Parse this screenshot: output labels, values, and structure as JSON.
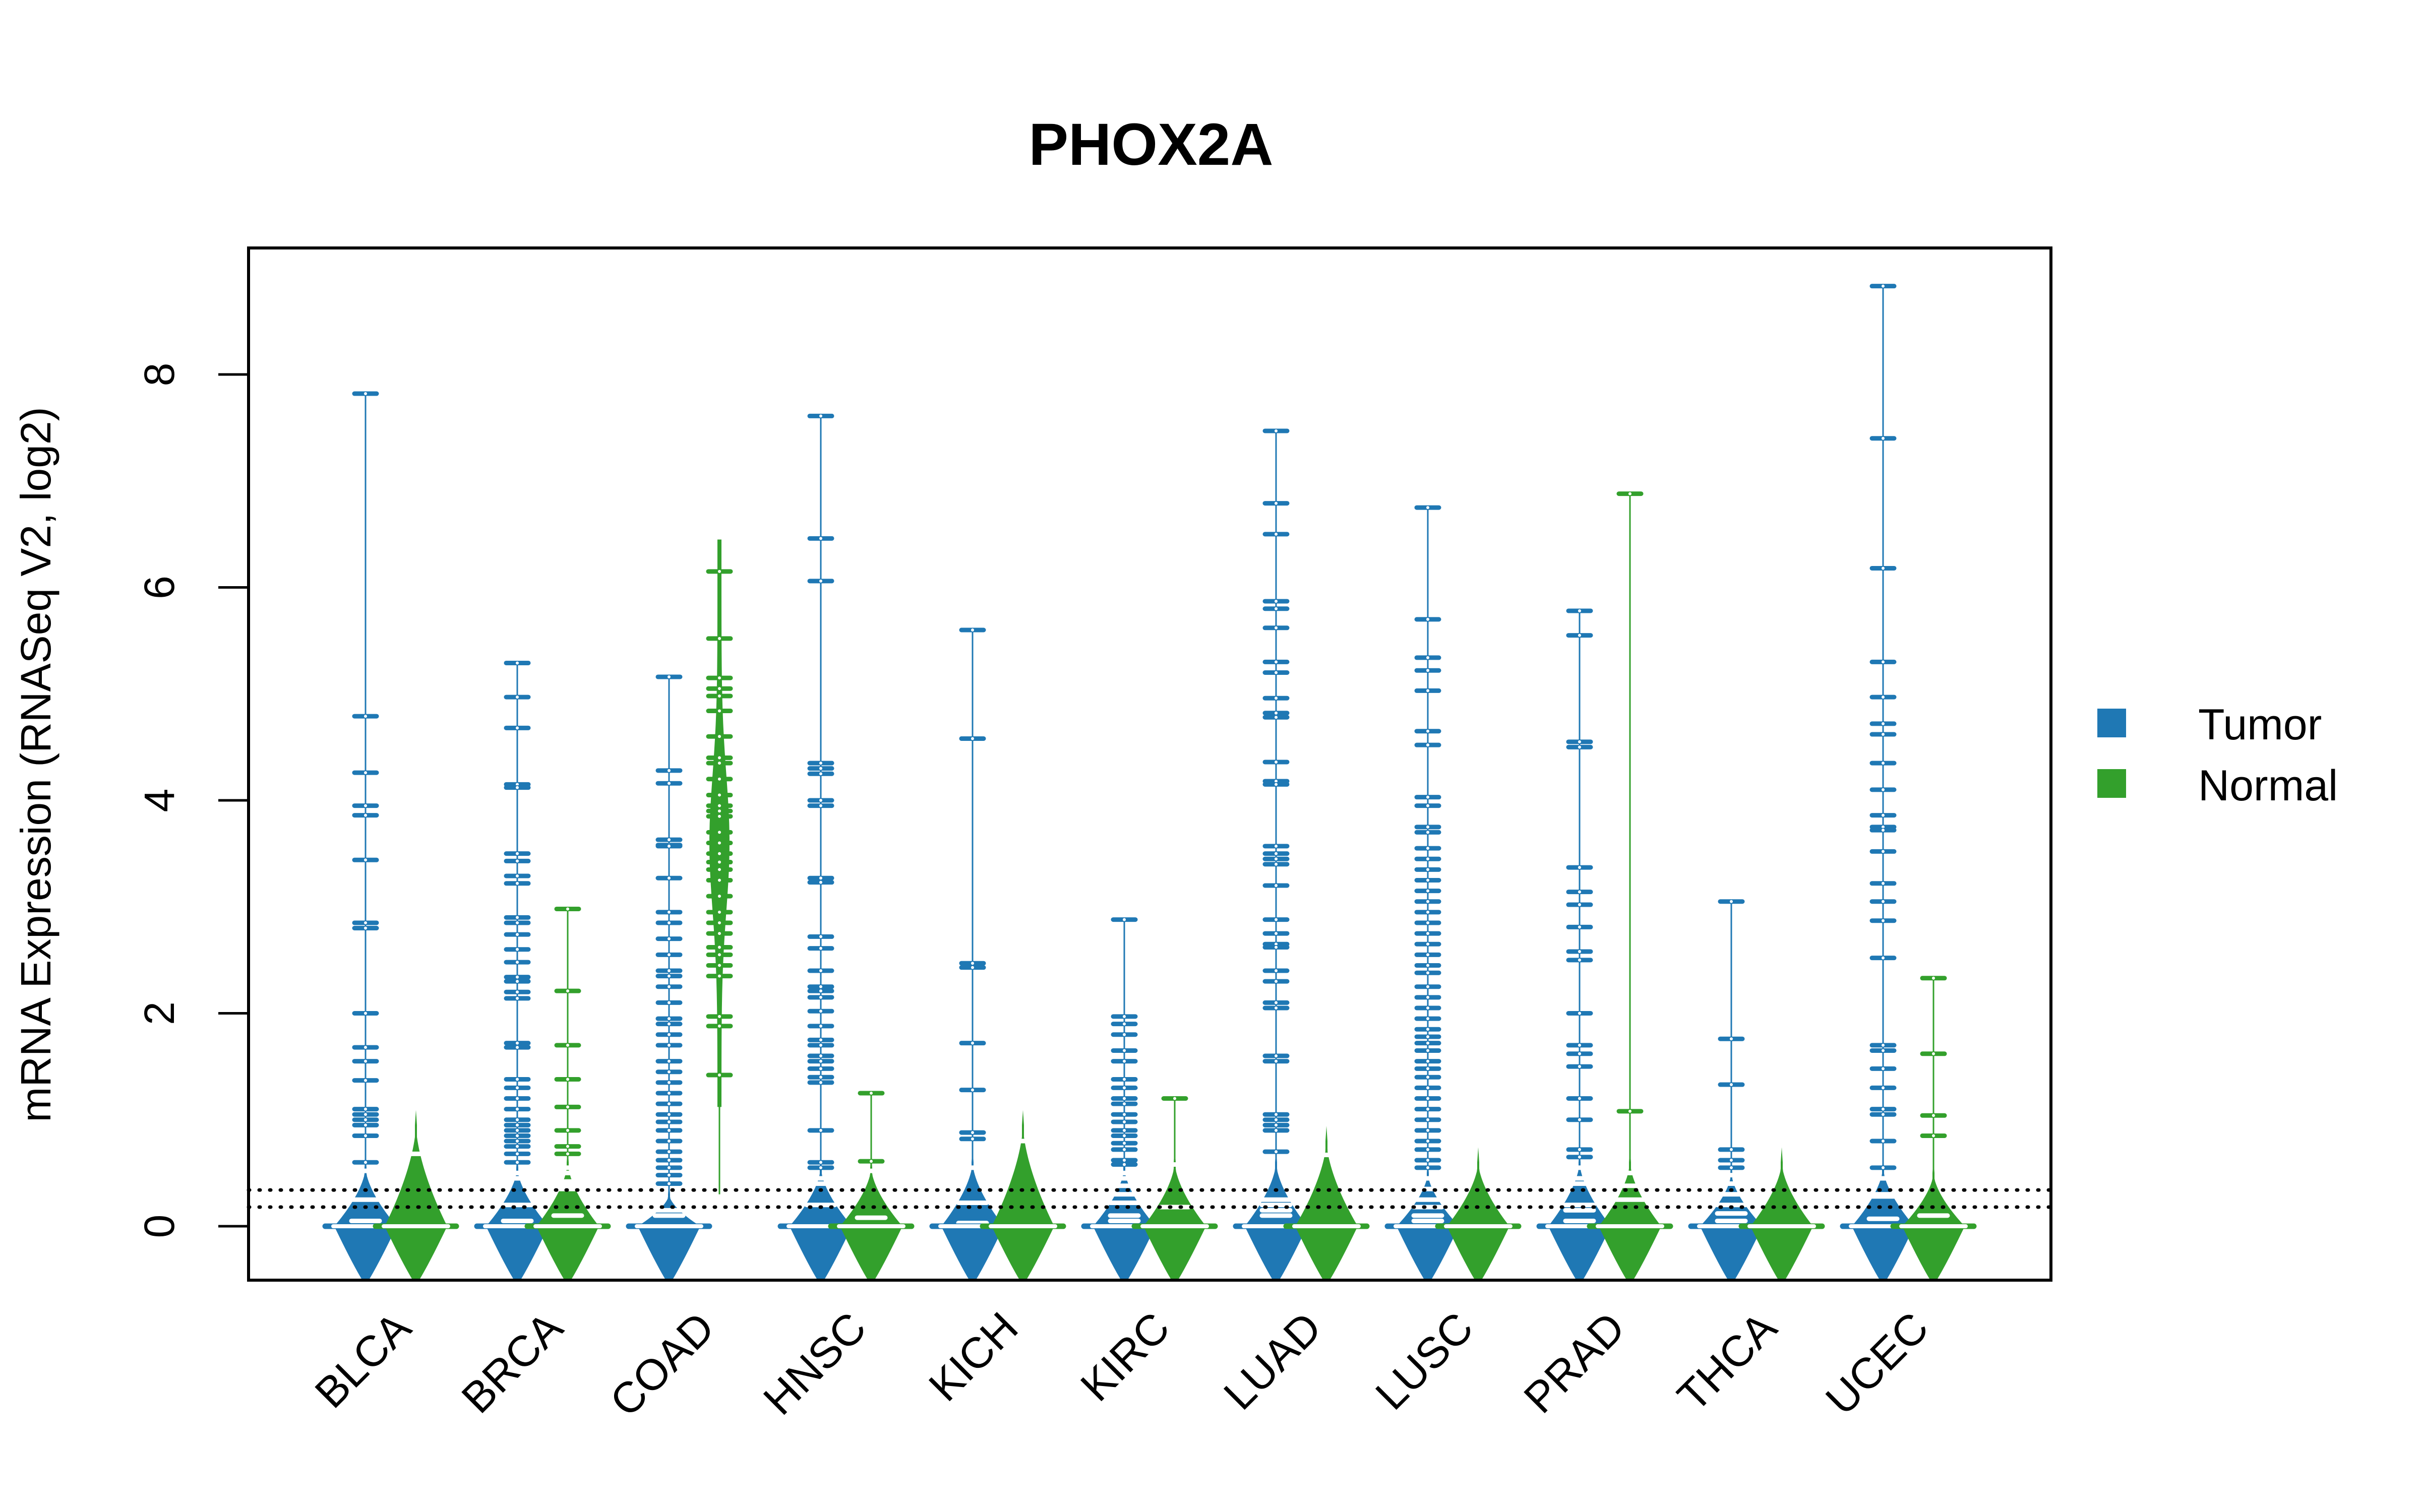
{
  "chart_data": {
    "type": "beanplot",
    "title": "PHOX2A",
    "xlabel": "",
    "ylabel": "mRNA Expression (RNASeq V2, log2)",
    "ylim": [
      -0.5,
      9.2
    ],
    "yticks": [
      0,
      2,
      4,
      6,
      8
    ],
    "categories": [
      "BLCA",
      "BRCA",
      "COAD",
      "HNSC",
      "KICH",
      "KIRC",
      "LUAD",
      "LUSC",
      "PRAD",
      "THCA",
      "UCEC"
    ],
    "reference_lines": [
      0.34,
      0.18
    ],
    "legend": {
      "placement": "right",
      "entries": [
        {
          "label": "Tumor",
          "color": "#1F78B4"
        },
        {
          "label": "Normal",
          "color": "#33A02C"
        }
      ]
    },
    "series": [
      {
        "name": "Tumor",
        "color": "#1F78B4",
        "groups": [
          {
            "category": "BLCA",
            "median": 0,
            "density_top": 0.55,
            "beans": [
              7.82,
              4.79,
              4.26,
              3.95,
              3.86,
              3.44,
              2.85,
              2.8,
              2.0,
              1.68,
              1.55,
              1.37,
              1.1,
              1.05,
              1.0,
              0.95,
              0.85,
              0.6,
              0.52,
              0.25,
              0.05
            ]
          },
          {
            "category": "BRCA",
            "median": 0,
            "density_top": 0.55,
            "beans": [
              5.29,
              4.97,
              4.68,
              4.15,
              4.12,
              3.5,
              3.43,
              3.29,
              3.22,
              2.9,
              2.85,
              2.74,
              2.6,
              2.48,
              2.34,
              2.3,
              2.2,
              2.14,
              1.72,
              1.68,
              1.38,
              1.3,
              1.2,
              1.1,
              1.0,
              0.95,
              0.9,
              0.85,
              0.8,
              0.75,
              0.68,
              0.6,
              0.5,
              0.45,
              0.2,
              0.05
            ]
          },
          {
            "category": "COAD",
            "median": 0,
            "density_top": 0.3,
            "beans": [
              5.16,
              4.28,
              4.16,
              3.63,
              3.58,
              3.57,
              3.27,
              2.95,
              2.85,
              2.7,
              2.55,
              2.4,
              2.35,
              2.25,
              2.1,
              1.95,
              1.9,
              1.8,
              1.7,
              1.55,
              1.45,
              1.35,
              1.25,
              1.15,
              1.05,
              0.98,
              0.9,
              0.8,
              0.7,
              0.62,
              0.55,
              0.48,
              0.4,
              0.15,
              0.1
            ]
          },
          {
            "category": "HNSC",
            "median": 0,
            "density_top": 0.55,
            "beans": [
              7.61,
              6.46,
              6.06,
              4.35,
              4.3,
              4.25,
              4.0,
              3.95,
              3.27,
              3.23,
              2.72,
              2.61,
              2.4,
              2.25,
              2.21,
              2.15,
              2.02,
              1.88,
              1.75,
              1.7,
              1.6,
              1.55,
              1.48,
              1.4,
              1.35,
              0.9,
              0.6,
              0.55,
              0.45,
              0.4,
              0.2
            ]
          },
          {
            "category": "KICH",
            "median": 0,
            "density_top": 0.6,
            "beans": [
              5.6,
              4.58,
              2.47,
              2.43,
              1.72,
              1.28,
              0.88,
              0.82,
              0.55,
              0.22,
              0.03
            ]
          },
          {
            "category": "KIRC",
            "median": 0,
            "density_top": 0.55,
            "beans": [
              2.88,
              1.97,
              1.9,
              1.8,
              1.65,
              1.55,
              1.38,
              1.3,
              1.2,
              1.15,
              1.05,
              0.98,
              0.9,
              0.85,
              0.78,
              0.72,
              0.62,
              0.58,
              0.5,
              0.45,
              0.38,
              0.3,
              0.22,
              0.1,
              0.05
            ]
          },
          {
            "category": "LUAD",
            "median": 0,
            "density_top": 0.6,
            "beans": [
              7.47,
              6.79,
              6.5,
              5.87,
              5.8,
              5.62,
              5.3,
              5.2,
              4.96,
              4.82,
              4.78,
              4.36,
              4.18,
              4.15,
              3.57,
              3.5,
              3.45,
              3.4,
              3.2,
              2.88,
              2.75,
              2.65,
              2.62,
              2.4,
              2.3,
              2.1,
              2.05,
              1.6,
              1.55,
              1.05,
              1.0,
              0.95,
              0.9,
              0.7,
              0.25,
              0.2,
              0.15,
              0.1
            ]
          },
          {
            "category": "LUSC",
            "median": 0,
            "density_top": 0.5,
            "beans": [
              6.75,
              5.7,
              5.34,
              5.22,
              5.03,
              4.65,
              4.52,
              4.03,
              3.95,
              3.75,
              3.7,
              3.55,
              3.45,
              3.35,
              3.25,
              3.15,
              3.05,
              2.95,
              2.85,
              2.75,
              2.65,
              2.55,
              2.45,
              2.38,
              2.25,
              2.15,
              2.05,
              1.95,
              1.85,
              1.78,
              1.72,
              1.65,
              1.55,
              1.48,
              1.4,
              1.3,
              1.2,
              1.1,
              1.0,
              0.9,
              0.8,
              0.72,
              0.62,
              0.55,
              0.45,
              0.35,
              0.25,
              0.18,
              0.1,
              0.05
            ]
          },
          {
            "category": "PRAD",
            "median": 0,
            "density_top": 0.6,
            "beans": [
              5.78,
              5.55,
              4.55,
              4.5,
              3.37,
              3.14,
              3.02,
              2.81,
              2.58,
              2.5,
              2.0,
              1.7,
              1.62,
              1.5,
              1.2,
              1.0,
              0.72,
              0.65,
              0.55,
              0.45,
              0.4,
              0.2,
              0.15,
              0.05
            ]
          },
          {
            "category": "THCA",
            "median": 0,
            "density_top": 0.5,
            "beans": [
              3.05,
              1.76,
              1.33,
              0.72,
              0.62,
              0.55,
              0.48,
              0.4,
              0.3,
              0.2,
              0.12,
              0.05
            ]
          },
          {
            "category": "UCEC",
            "median": 0,
            "density_top": 0.55,
            "beans": [
              8.83,
              7.4,
              6.18,
              5.3,
              4.97,
              4.72,
              4.62,
              4.35,
              4.1,
              3.86,
              3.75,
              3.72,
              3.52,
              3.22,
              3.05,
              2.87,
              2.52,
              1.7,
              1.65,
              1.48,
              1.3,
              1.1,
              1.05,
              0.8,
              0.55,
              0.45,
              0.3,
              0.28,
              0.07
            ]
          }
        ]
      },
      {
        "name": "Normal",
        "color": "#33A02C",
        "groups": [
          {
            "category": "BLCA",
            "median": 0,
            "density_top": 0.95,
            "beans": [
              0.68
            ]
          },
          {
            "category": "BRCA",
            "median": 0,
            "density_top": 0.6,
            "beans": [
              2.98,
              2.21,
              1.7,
              1.38,
              1.12,
              0.9,
              0.75,
              0.68,
              0.55,
              0.5,
              0.42,
              0.38,
              0.35,
              0.1
            ]
          },
          {
            "category": "COAD",
            "median": null,
            "density_top": null,
            "beans": [
              6.15,
              5.52,
              5.15,
              5.05,
              4.98,
              4.84,
              4.6,
              4.4,
              4.35,
              4.2,
              4.05,
              3.95,
              3.9,
              3.85,
              3.7,
              3.6,
              3.5,
              3.42,
              3.35,
              3.25,
              3.1,
              2.95,
              2.85,
              2.75,
              2.62,
              2.55,
              2.45,
              2.35,
              1.97,
              1.88,
              1.42
            ]
          },
          {
            "category": "HNSC",
            "median": 0,
            "density_top": 0.55,
            "beans": [
              1.25,
              0.61,
              0.52,
              0.08
            ]
          },
          {
            "category": "KICH",
            "median": 0,
            "density_top": 0.95,
            "beans": [
              0.8
            ]
          },
          {
            "category": "KIRC",
            "median": 0,
            "density_top": 0.6,
            "beans": [
              1.2,
              0.58,
              0.18
            ]
          },
          {
            "category": "LUAD",
            "median": 0,
            "density_top": 0.8,
            "beans": [
              0.67
            ]
          },
          {
            "category": "LUSC",
            "median": 0,
            "density_top": 0.6,
            "beans": []
          },
          {
            "category": "PRAD",
            "median": 0,
            "density_top": 0.6,
            "beans": [
              6.88,
              1.08,
              0.5,
              0.38,
              0.25
            ]
          },
          {
            "category": "THCA",
            "median": 0,
            "density_top": 0.6,
            "beans": []
          },
          {
            "category": "UCEC",
            "median": 0,
            "density_top": 0.5,
            "beans": [
              2.33,
              1.62,
              1.04,
              0.85,
              0.1
            ]
          }
        ]
      }
    ]
  }
}
